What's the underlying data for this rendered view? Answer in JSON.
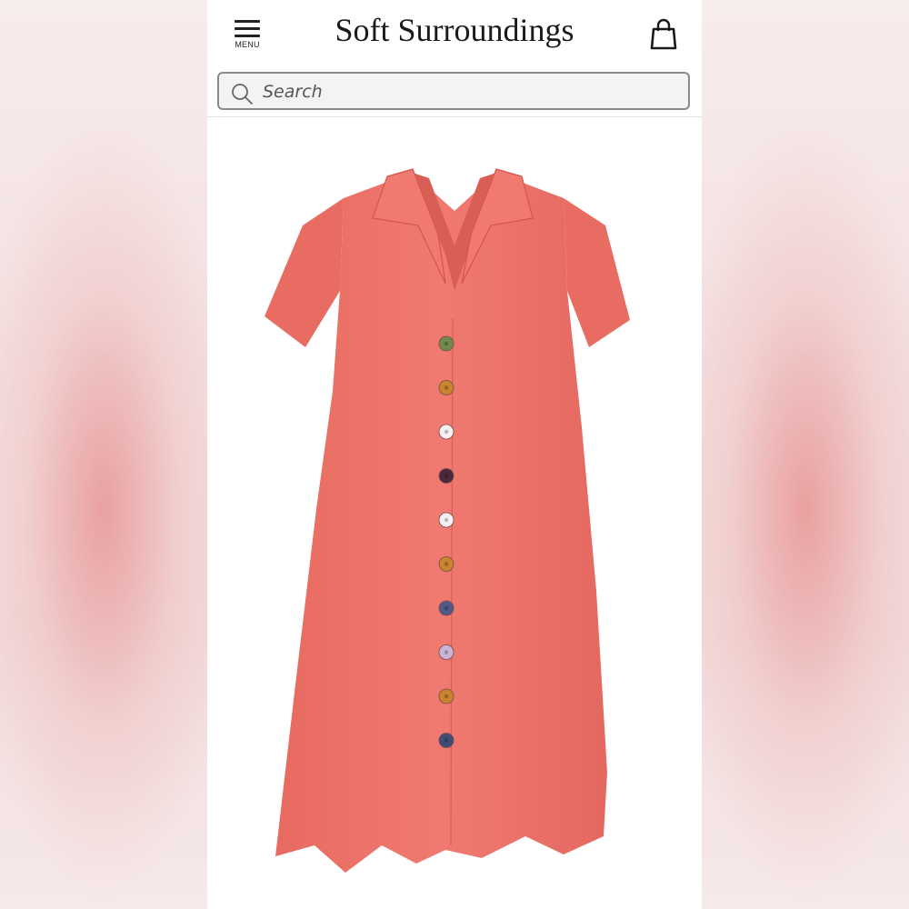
{
  "header": {
    "menu_label": "MENU",
    "brand": "Soft Surroundings",
    "menu_icon": "hamburger-icon",
    "bag_icon": "shopping-bag-icon"
  },
  "search": {
    "placeholder": "Search",
    "icon": "search-icon"
  },
  "product": {
    "color": "#ee7369",
    "button_colors": [
      "#6f8a4a",
      "#c9852e",
      "#f4f0f2",
      "#4a2a3a",
      "#f4f0f2",
      "#c9852e",
      "#4f5a86",
      "#c9b5d6",
      "#c9852e",
      "#3f4d76"
    ]
  }
}
